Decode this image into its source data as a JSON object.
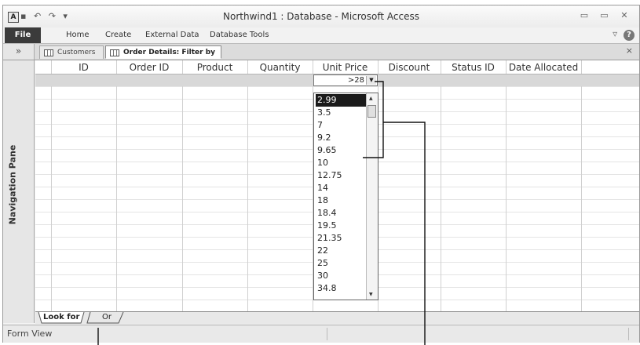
{
  "window": {
    "app_icon_letter": "A",
    "title": "Northwind1 : Database - Microsoft Access",
    "minimize_glyph": "▭",
    "restore_glyph": "▭",
    "close_glyph": "✕"
  },
  "ribbon": {
    "tabs": [
      "File",
      "Home",
      "Create",
      "External Data",
      "Database Tools"
    ],
    "help_glyph": "?"
  },
  "document_tabs": {
    "nav_toggle": "»",
    "tabs": [
      "Customers",
      "Order Details: Filter by Form"
    ],
    "close_glyph": "×"
  },
  "navigation_pane": {
    "label": "Navigation Pane"
  },
  "grid": {
    "columns": [
      "ID",
      "Order ID",
      "Product",
      "Quantity",
      "Unit Price",
      "Discount",
      "Status ID",
      "Date Allocated"
    ],
    "filter": {
      "column": "Unit Price",
      "value": ">28"
    }
  },
  "dropdown": {
    "items": [
      "2.99",
      "3.5",
      "7",
      "9.2",
      "9.65",
      "10",
      "12.75",
      "14",
      "18",
      "18.4",
      "19.5",
      "21.35",
      "22",
      "25",
      "30",
      "34.8"
    ],
    "selected": "2.99"
  },
  "sheet_tabs": [
    "Look for",
    "Or"
  ],
  "status_bar": {
    "text": "Form View"
  },
  "colors": {
    "file_tab_bg": "#3b3b3b",
    "selected_item_bg": "#1b1b1b"
  }
}
